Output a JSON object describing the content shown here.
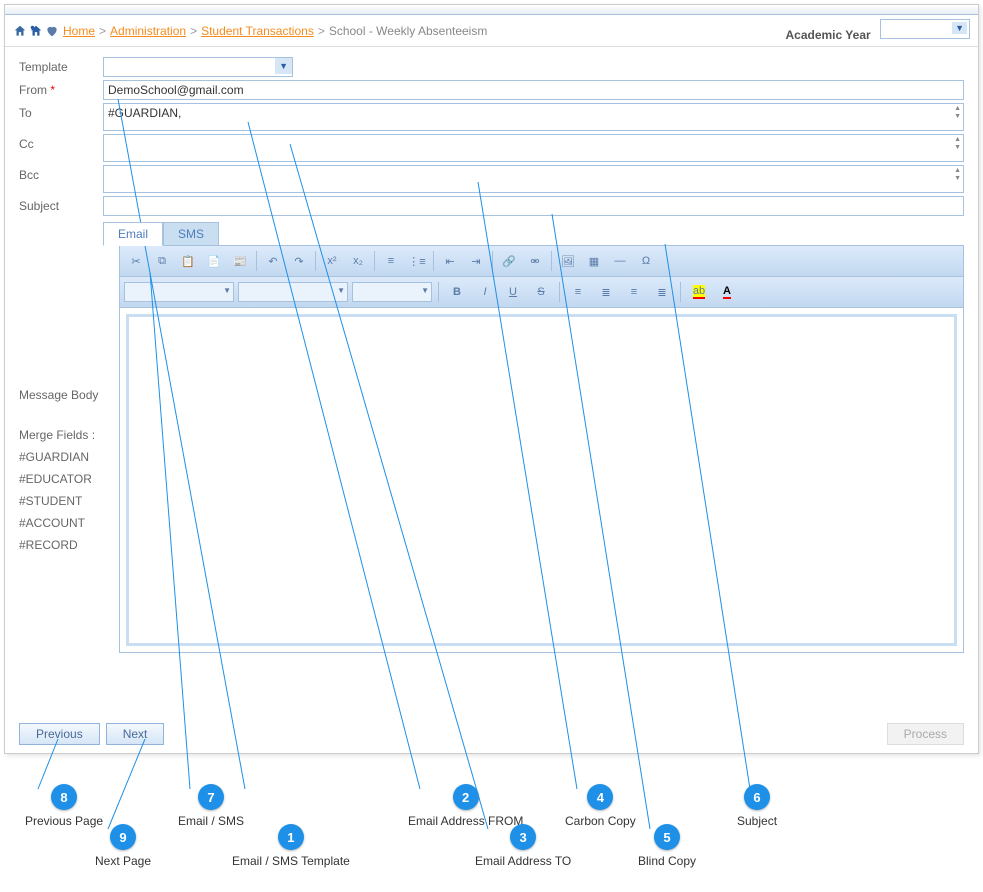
{
  "breadcrumb": {
    "home": "Home",
    "admin": "Administration",
    "trans": "Student Transactions",
    "current": "School - Weekly Absenteeism"
  },
  "academic_year_label": "Academic Year",
  "labels": {
    "template": "Template",
    "from": "From",
    "to": "To",
    "cc": "Cc",
    "bcc": "Bcc",
    "subject": "Subject",
    "message_body": "Message Body",
    "merge_fields": "Merge Fields :"
  },
  "values": {
    "from": "DemoSchool@gmail.com",
    "to": "#GUARDIAN,",
    "cc": "",
    "bcc": "",
    "subject": ""
  },
  "merge_fields": [
    "#GUARDIAN",
    "#EDUCATOR",
    "#STUDENT",
    "#ACCOUNT",
    "#RECORD"
  ],
  "tabs": {
    "email": "Email",
    "sms": "SMS"
  },
  "buttons": {
    "prev": "Previous",
    "next": "Next",
    "process": "Process"
  },
  "callouts": {
    "1": "Email / SMS Template",
    "2": "Email Address FROM",
    "3": "Email Address TO",
    "4": "Carbon Copy",
    "5": "Blind Copy",
    "6": "Subject",
    "7": "Email / SMS",
    "8": "Previous Page",
    "9": "Next Page"
  }
}
